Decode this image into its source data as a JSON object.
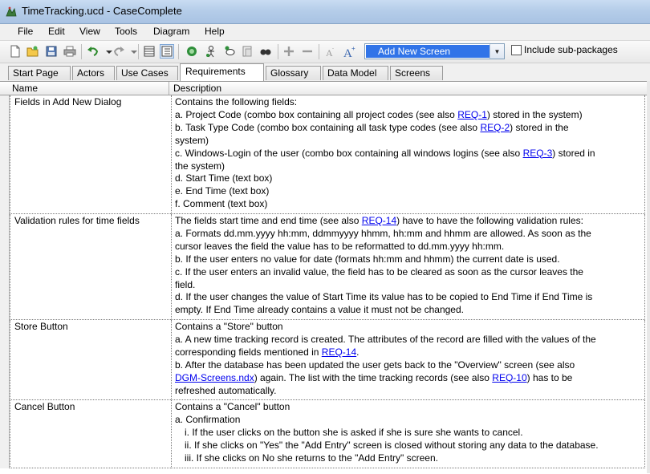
{
  "window": {
    "title": "TimeTracking.ucd - CaseComplete"
  },
  "menu": [
    "File",
    "Edit",
    "View",
    "Tools",
    "Diagram",
    "Help"
  ],
  "toolbar": {
    "icons": [
      "new-icon",
      "open-icon",
      "save-icon",
      "print-icon",
      "undo-icon",
      "redo-icon",
      "grid-view-icon",
      "list-view-icon",
      "add-actor-icon",
      "add-use-case-icon",
      "add-requirement-icon",
      "add-glossary-icon",
      "find-icon",
      "plus-icon",
      "minus-icon",
      "font-smaller-icon",
      "font-larger-icon"
    ],
    "screen_select": "Add New Screen",
    "include_subpackages_label": "Include sub-packages",
    "include_subpackages_checked": false
  },
  "tabs": [
    "Start Page",
    "Actors",
    "Use Cases",
    "Requirements",
    "Glossary",
    "Data Model",
    "Screens"
  ],
  "active_tab": "Requirements",
  "table": {
    "columns": [
      "Name",
      "Description"
    ],
    "rows": [
      {
        "name": "Fields in Add New Dialog",
        "lines": [
          [
            {
              "t": "Contains the following fields:"
            }
          ],
          [
            {
              "t": "a. Project Code (combo box containing all project codes (see also "
            },
            {
              "link": "REQ-1"
            },
            {
              "t": ") stored in the system)"
            }
          ],
          [
            {
              "t": "b. Task Type Code (combo box containing all task type codes (see also "
            },
            {
              "link": "REQ-2"
            },
            {
              "t": ") stored in the"
            }
          ],
          [
            {
              "t": "system)"
            }
          ],
          [
            {
              "t": "c. Windows-Login of the user (combo box containing all windows logins (see also "
            },
            {
              "link": "REQ-3"
            },
            {
              "t": ") stored in"
            }
          ],
          [
            {
              "t": "the system)"
            }
          ],
          [
            {
              "t": "d. Start Time (text box)"
            }
          ],
          [
            {
              "t": "e. End Time (text box)"
            }
          ],
          [
            {
              "t": "f. Comment (text box)"
            }
          ]
        ]
      },
      {
        "name": "Validation rules for time fields",
        "lines": [
          [
            {
              "t": "The fields start time and end time (see also "
            },
            {
              "link": "REQ-14"
            },
            {
              "t": ") have to have the following validation rules:"
            }
          ],
          [
            {
              "t": "a. Formats dd.mm.yyyy hh:mm, ddmmyyyy hhmm, hh:mm and hhmm are allowed. As soon as the"
            }
          ],
          [
            {
              "t": "cursor leaves the field the value has to be reformatted to dd.mm.yyyy hh:mm."
            }
          ],
          [
            {
              "t": "b. If the user enters no value for date (formats hh:mm and hhmm) the current date is used."
            }
          ],
          [
            {
              "t": "c. If the user enters an invalid value, the field has to be cleared as soon as the cursor leaves the"
            }
          ],
          [
            {
              "t": "field."
            }
          ],
          [
            {
              "t": "d. If the user changes the value of Start Time its value has to be copied to End Time if End Time is"
            }
          ],
          [
            {
              "t": "empty. If End Time already contains a value it must not be changed."
            }
          ]
        ]
      },
      {
        "name": "Store Button",
        "lines": [
          [
            {
              "t": "Contains a \"Store\" button"
            }
          ],
          [
            {
              "t": "a. A new time tracking record is created. The attributes of the record are filled with the values of the"
            }
          ],
          [
            {
              "t": "corresponding fields mentioned in "
            },
            {
              "link": "REQ-14"
            },
            {
              "t": "."
            }
          ],
          [
            {
              "t": "b. After the database has been updated the user gets back to the \"Overview\" screen (see also"
            }
          ],
          [
            {
              "link": "DGM-Screens.ndx"
            },
            {
              "t": ") again. The list with the time tracking records (see also "
            },
            {
              "link": "REQ-10"
            },
            {
              "t": ") has to be"
            }
          ],
          [
            {
              "t": "refreshed automatically."
            }
          ]
        ]
      },
      {
        "name": "Cancel Button",
        "lines": [
          [
            {
              "t": "Contains a \"Cancel\" button"
            }
          ],
          [
            {
              "t": "a. Confirmation"
            }
          ],
          [
            {
              "t": "i. If the user clicks on the button she is asked if she is sure she wants to cancel.",
              "indent": 1
            }
          ],
          [
            {
              "t": "ii. If she clicks on \"Yes\" the \"Add Entry\" screen is closed without storing any data to the database.",
              "indent": 1
            }
          ],
          [
            {
              "t": "iii. If she clicks on No she returns to the \"Add Entry\" screen.",
              "indent": 1
            }
          ]
        ]
      }
    ]
  }
}
